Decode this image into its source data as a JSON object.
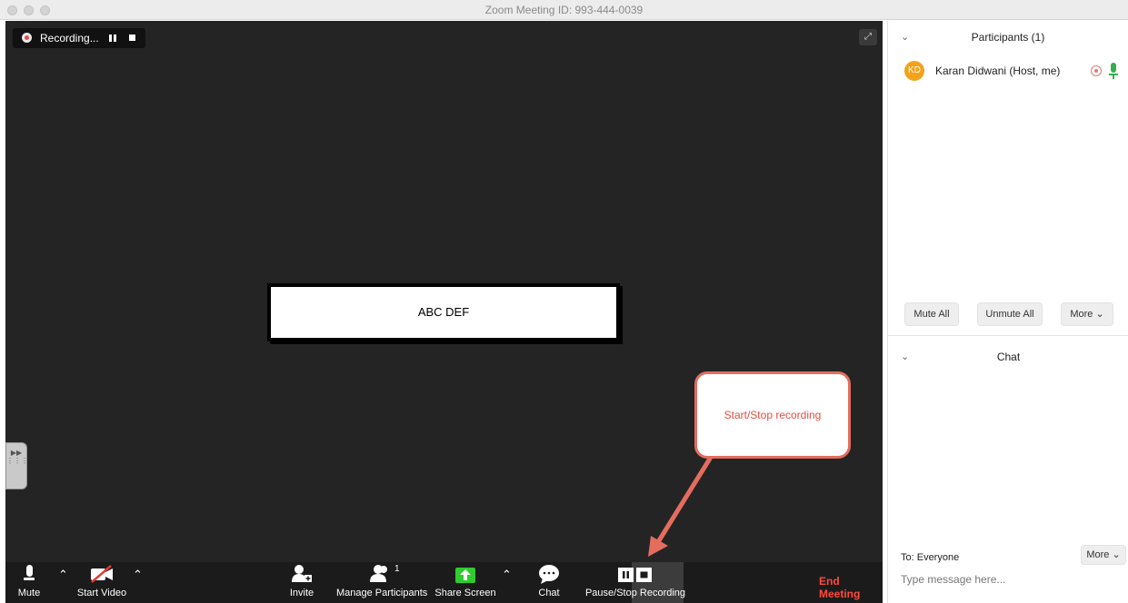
{
  "window": {
    "title": "Zoom Meeting ID: 993-444-0039"
  },
  "recording_indicator": {
    "label": "Recording..."
  },
  "video": {
    "participant_name": "ABC DEF"
  },
  "callout": {
    "text": "Start/Stop recording"
  },
  "toolbar": {
    "mute_label": "Mute",
    "start_video_label": "Start Video",
    "invite_label": "Invite",
    "manage_participants_label": "Manage Participants",
    "participants_count": "1",
    "share_screen_label": "Share Screen",
    "chat_label": "Chat",
    "pause_stop_recording_label": "Pause/Stop Recording",
    "end_meeting_label": "End Meeting"
  },
  "participants_panel": {
    "title": "Participants (1)",
    "participants": [
      {
        "initials": "KD",
        "name": "Karan Didwani (Host, me)"
      }
    ],
    "mute_all_label": "Mute All",
    "unmute_all_label": "Unmute All",
    "more_label": "More"
  },
  "chat_panel": {
    "title": "Chat",
    "to_label": "To: Everyone",
    "more_label": "More",
    "input_placeholder": "Type message here..."
  },
  "colors": {
    "end_meeting": "#ff4a3d",
    "share_screen": "#2ecc2e",
    "avatar": "#f2a31b",
    "callout_border": "#e46d5f"
  }
}
